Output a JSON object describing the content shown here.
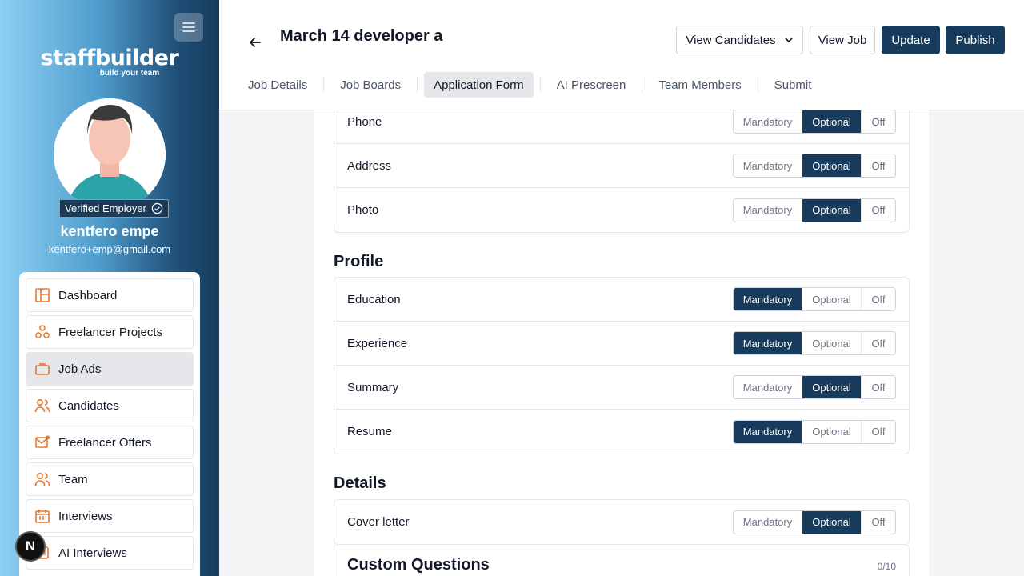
{
  "sidebar": {
    "brand": "staffbuilder",
    "tagline": "build your team",
    "verified_label": "Verified Employer",
    "user_name": "kentfero empe",
    "user_email": "kentfero+emp@gmail.com",
    "items": [
      {
        "label": "Dashboard",
        "icon": "layout-icon"
      },
      {
        "label": "Freelancer Projects",
        "icon": "circles-icon"
      },
      {
        "label": "Job Ads",
        "icon": "briefcase-icon"
      },
      {
        "label": "Candidates",
        "icon": "users-icon"
      },
      {
        "label": "Freelancer Offers",
        "icon": "mail-icon"
      },
      {
        "label": "Team",
        "icon": "users-icon"
      },
      {
        "label": "Interviews",
        "icon": "calendar-icon"
      },
      {
        "label": "AI Interviews",
        "icon": "ai-icon"
      }
    ],
    "active_item": "Job Ads",
    "badge": "N"
  },
  "header": {
    "title": "March 14 developer a",
    "view_candidates": "View Candidates",
    "view_job": "View Job",
    "update": "Update",
    "publish": "Publish",
    "tabs": [
      "Job Details",
      "Job Boards",
      "Application Form",
      "AI Prescreen",
      "Team Members",
      "Submit"
    ],
    "active_tab": "Application Form"
  },
  "options": {
    "mandatory": "Mandatory",
    "optional": "Optional",
    "off": "Off"
  },
  "contact_rows": [
    {
      "label": "Phone",
      "value": "optional"
    },
    {
      "label": "Address",
      "value": "optional"
    },
    {
      "label": "Photo",
      "value": "optional"
    }
  ],
  "profile": {
    "title": "Profile",
    "rows": [
      {
        "label": "Education",
        "value": "mandatory"
      },
      {
        "label": "Experience",
        "value": "mandatory"
      },
      {
        "label": "Summary",
        "value": "optional"
      },
      {
        "label": "Resume",
        "value": "mandatory"
      }
    ]
  },
  "details": {
    "title": "Details",
    "rows": [
      {
        "label": "Cover letter",
        "value": "optional"
      }
    ]
  },
  "custom_questions": {
    "title": "Custom Questions",
    "count": "0/10"
  },
  "colors": {
    "primary": "#173b5c",
    "accent_icon": "#e8772e"
  }
}
